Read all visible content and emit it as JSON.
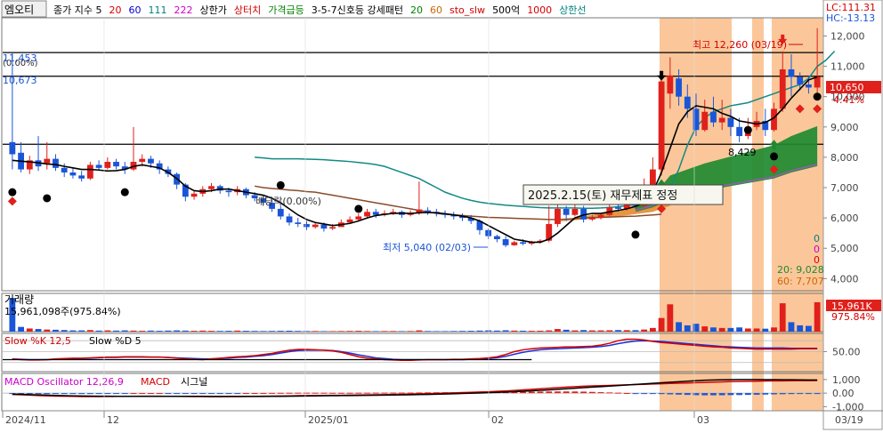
{
  "toolbar": {
    "stock_name": "엠오티",
    "legend": [
      {
        "text": "종가 지수 5",
        "color": "#000000"
      },
      {
        "text": "20",
        "color": "#d40000"
      },
      {
        "text": "60",
        "color": "#0000cc"
      },
      {
        "text": "111",
        "color": "#008080"
      },
      {
        "text": "222",
        "color": "#cc00cc"
      },
      {
        "text": "상한가",
        "color": "#000000"
      },
      {
        "text": "상터치",
        "color": "#d40000"
      },
      {
        "text": "가격급등",
        "color": "#008000"
      },
      {
        "text": "3-5-7신호등 강세패턴",
        "color": "#000000"
      },
      {
        "text": "20",
        "color": "#008000"
      },
      {
        "text": "60",
        "color": "#cc6600"
      },
      {
        "text": "sto_slw",
        "color": "#d40000"
      },
      {
        "text": "500억",
        "color": "#000000"
      },
      {
        "text": "1000",
        "color": "#d40000"
      },
      {
        "text": "상한선",
        "color": "#008080"
      }
    ]
  },
  "price_panel": {
    "lc": "LC:111.31",
    "hc": "HC:-13.13",
    "y_ticks": [
      "12,000",
      "11,000",
      "10,000",
      "9,000",
      "8,000",
      "7,000",
      "6,000",
      "5,000",
      "4,000"
    ],
    "current_price": "10,650",
    "current_pct": "4.41%",
    "high_label": "최고 12,260 (03/19)",
    "low_label": "최저 5,040 (02/03)",
    "level_8429": "8,429",
    "left_11453": "11,453",
    "left_pct": "(0.00%)",
    "left_10673": "10,673",
    "dividend": "배당락(0.00%)",
    "event_label": "2025.2.15(토) 재무제표 정정",
    "zero_labels": [
      "0",
      "0",
      "0"
    ],
    "ma20_label": "20: 9,028",
    "ma60_label": "60: 7,707"
  },
  "volume_panel": {
    "title": "거래량",
    "value": "15,961,098주(975.84%)",
    "badge": "15,961K",
    "badge_pct": "975.84%"
  },
  "stochastic_panel": {
    "title_k": "Slow %K 12,5",
    "title_d": "Slow %D 5",
    "tick": "50.00"
  },
  "macd_panel": {
    "title_osc": "MACD Oscillator 12,26,9",
    "title_macd": "MACD",
    "title_signal": "시그널",
    "ticks": [
      "1,000",
      "0.00",
      "-1,000"
    ]
  },
  "x_axis": {
    "labels": [
      "2024/11",
      "12",
      "2025/01",
      "02",
      "03",
      "03/19"
    ]
  },
  "colors": {
    "up": "#e0201b",
    "down": "#1a55d8",
    "highlight": "#fbc79a",
    "ma_teal": "#108a84",
    "ma_brown": "#8b4a2a",
    "cloud_green": "#1e8a30",
    "cloud_orange": "#e68a2e"
  },
  "chart_data": {
    "type": "candlestick",
    "candles": [
      [
        8500,
        8100,
        11453,
        7600
      ],
      [
        8150,
        7600,
        8500,
        7500
      ],
      [
        7600,
        7900,
        8050,
        7450
      ],
      [
        7900,
        7700,
        8700,
        7550
      ],
      [
        7800,
        7950,
        8500,
        7600
      ],
      [
        7950,
        7650,
        8100,
        7550
      ],
      [
        7650,
        7500,
        7800,
        7350
      ],
      [
        7500,
        7400,
        7650,
        7300
      ],
      [
        7400,
        7300,
        7550,
        7200
      ],
      [
        7300,
        7750,
        7850,
        7250
      ],
      [
        7750,
        7650,
        7900,
        7550
      ],
      [
        7650,
        7850,
        8000,
        7600
      ],
      [
        7850,
        7700,
        7950,
        7600
      ],
      [
        7700,
        7600,
        7850,
        7450
      ],
      [
        7600,
        7850,
        9000,
        7550
      ],
      [
        7850,
        7950,
        8100,
        7700
      ],
      [
        7950,
        7800,
        8050,
        7650
      ],
      [
        7800,
        7600,
        7900,
        7450
      ],
      [
        7600,
        7450,
        7700,
        7350
      ],
      [
        7450,
        7100,
        7500,
        6950
      ],
      [
        7100,
        6700,
        7150,
        6550
      ],
      [
        6700,
        6800,
        6900,
        6600
      ],
      [
        6800,
        6950,
        7050,
        6700
      ],
      [
        6950,
        7050,
        7150,
        6850
      ],
      [
        7050,
        6900,
        7100,
        6800
      ],
      [
        6900,
        6850,
        7000,
        6700
      ],
      [
        6850,
        6950,
        7050,
        6750
      ],
      [
        6950,
        6750,
        7000,
        6650
      ],
      [
        6750,
        6650,
        6850,
        6550
      ],
      [
        6650,
        6500,
        6750,
        6400
      ],
      [
        6500,
        6300,
        6600,
        6200
      ],
      [
        6300,
        6050,
        6400,
        5950
      ],
      [
        6050,
        5850,
        6150,
        5750
      ],
      [
        5850,
        5800,
        6000,
        5700
      ],
      [
        5800,
        5700,
        5900,
        5600
      ],
      [
        5700,
        5780,
        5850,
        5650
      ],
      [
        5780,
        5650,
        5850,
        5550
      ],
      [
        5650,
        5700,
        5800,
        5600
      ],
      [
        5700,
        5850,
        5950,
        5750
      ],
      [
        5850,
        5950,
        6050,
        5850
      ],
      [
        5950,
        6050,
        6150,
        5900
      ],
      [
        6050,
        6200,
        6300,
        6000
      ],
      [
        6200,
        6100,
        6300,
        6000
      ],
      [
        6100,
        6150,
        6250,
        6050
      ],
      [
        6150,
        6200,
        6300,
        6100
      ],
      [
        6200,
        6100,
        6250,
        6000
      ],
      [
        6100,
        6150,
        6250,
        6050
      ],
      [
        6150,
        6280,
        7200,
        6100
      ],
      [
        6250,
        6200,
        6350,
        6100
      ],
      [
        6200,
        6150,
        6300,
        6050
      ],
      [
        6150,
        6100,
        6250,
        6000
      ],
      [
        6100,
        6050,
        6200,
        5950
      ],
      [
        6050,
        6000,
        6150,
        5900
      ],
      [
        6000,
        5900,
        6100,
        5800
      ],
      [
        5900,
        5600,
        5950,
        5450
      ],
      [
        5600,
        5400,
        5650,
        5300
      ],
      [
        5400,
        5300,
        5450,
        5200
      ],
      [
        5300,
        5100,
        5400,
        5040
      ],
      [
        5100,
        5200,
        5250,
        5080
      ],
      [
        5200,
        5150,
        5300,
        5100
      ],
      [
        5150,
        5200,
        5250,
        5100
      ],
      [
        5200,
        5250,
        5300,
        5150
      ],
      [
        5250,
        5800,
        6400,
        5200
      ],
      [
        5800,
        6300,
        6600,
        5700
      ],
      [
        6300,
        6100,
        6400,
        5900
      ],
      [
        6100,
        6300,
        6500,
        6050
      ],
      [
        6300,
        5950,
        6400,
        5850
      ],
      [
        5950,
        6000,
        6100,
        5900
      ],
      [
        6000,
        6100,
        6150,
        5950
      ],
      [
        6100,
        6350,
        6500,
        6050
      ],
      [
        6350,
        6300,
        6450,
        6200
      ],
      [
        6300,
        6500,
        6650,
        6250
      ],
      [
        6500,
        6400,
        6600,
        6300
      ],
      [
        6400,
        6800,
        7300,
        6350
      ],
      [
        6800,
        7600,
        8000,
        6700
      ],
      [
        7600,
        10500,
        10700,
        7400
      ],
      [
        10100,
        10700,
        11300,
        9600
      ],
      [
        10600,
        10000,
        10900,
        9700
      ],
      [
        10000,
        9600,
        10400,
        9300
      ],
      [
        9600,
        8900,
        10100,
        8700
      ],
      [
        8900,
        9500,
        9900,
        8850
      ],
      [
        9500,
        9150,
        10000,
        9000
      ],
      [
        9150,
        9300,
        9900,
        8900
      ],
      [
        9300,
        9000,
        9600,
        8700
      ],
      [
        9000,
        8700,
        9300,
        8500
      ],
      [
        8700,
        9000,
        9300,
        8600
      ],
      [
        9000,
        9200,
        9500,
        8900
      ],
      [
        9200,
        8900,
        9600,
        8700
      ],
      [
        8900,
        9600,
        9800,
        8850
      ],
      [
        9600,
        10900,
        11500,
        9500
      ],
      [
        10900,
        10650,
        11400,
        10000
      ],
      [
        10650,
        10400,
        10800,
        10200
      ],
      [
        10400,
        10300,
        10700,
        10100
      ],
      [
        10300,
        10650,
        12260,
        10100
      ]
    ],
    "volume": [
      3.2,
      0.45,
      0.3,
      0.25,
      0.2,
      0.18,
      0.15,
      0.12,
      0.12,
      0.15,
      0.1,
      0.12,
      0.1,
      0.12,
      0.1,
      0.08,
      0.1,
      0.08,
      0.1,
      0.12,
      0.1,
      0.08,
      0.1,
      0.08,
      0.07,
      0.08,
      0.1,
      0.08,
      0.07,
      0.06,
      0.07,
      0.08,
      0.09,
      0.07,
      0.06,
      0.06,
      0.05,
      0.05,
      0.06,
      0.07,
      0.08,
      0.06,
      0.05,
      0.06,
      0.06,
      0.05,
      0.06,
      0.12,
      0.06,
      0.05,
      0.05,
      0.06,
      0.07,
      0.08,
      0.1,
      0.12,
      0.1,
      0.13,
      0.1,
      0.09,
      0.08,
      0.09,
      0.12,
      0.25,
      0.18,
      0.12,
      0.15,
      0.12,
      0.12,
      0.13,
      0.15,
      0.14,
      0.14,
      0.2,
      0.35,
      1.3,
      2.6,
      0.9,
      0.6,
      0.75,
      0.5,
      0.4,
      0.35,
      0.35,
      0.4,
      0.3,
      0.3,
      0.28,
      0.4,
      2.7,
      0.9,
      0.6,
      0.55,
      2.8
    ],
    "ma_teal_start": 28,
    "ma_teal": [
      8000,
      7980,
      7950,
      7950,
      7950,
      7950,
      7940,
      7930,
      7920,
      7900,
      7880,
      7860,
      7830,
      7800,
      7760,
      7700,
      7600,
      7500,
      7400,
      7300,
      7150,
      7000,
      6850,
      6750,
      6650,
      6580,
      6520,
      6480,
      6450,
      6420,
      6400,
      6380,
      6360,
      6340,
      6330,
      6330,
      6330,
      6330,
      6320,
      6320,
      6330,
      6350,
      6370,
      6400,
      6450,
      6500,
      6550,
      6700,
      7000,
      7600,
      8400,
      9000,
      9300,
      9500,
      9600,
      9700,
      9750,
      9800,
      9900,
      10000,
      10100,
      10200,
      10300,
      10400,
      10600,
      11000,
      11200,
      11500
    ],
    "ma_brown_start": 28,
    "ma_brown": [
      7050,
      7000,
      6970,
      6950,
      6920,
      6900,
      6870,
      6850,
      6800,
      6750,
      6700,
      6650,
      6600,
      6550,
      6500,
      6450,
      6400,
      6350,
      6300,
      6250,
      6200,
      6150,
      6120,
      6100,
      6080,
      6060,
      6040,
      6020,
      6010,
      6000,
      5990,
      5980,
      5970,
      5960,
      5950,
      5950,
      5960,
      5980,
      6000,
      6010,
      6020,
      6030,
      6040,
      6050,
      6060,
      6080,
      6100,
      6120
    ],
    "ma5": [
      7900,
      7870,
      7850,
      7820,
      7780,
      7760,
      7700,
      7650,
      7600,
      7600,
      7580,
      7550,
      7560,
      7600,
      7700,
      7750,
      7700,
      7650,
      7500,
      7300,
      7050,
      6900,
      6870,
      6900,
      6950,
      6950,
      6900,
      6850,
      6800,
      6750,
      6650,
      6500,
      6300,
      6100,
      5950,
      5850,
      5800,
      5750,
      5780,
      5820,
      5900,
      6000,
      6080,
      6120,
      6150,
      6160,
      6150,
      6170,
      6180,
      6170,
      6140,
      6100,
      6060,
      6000,
      5900,
      5750,
      5600,
      5450,
      5300,
      5250,
      5200,
      5200,
      5300,
      5500,
      5750,
      6000,
      6100,
      6150,
      6150,
      6200,
      6250,
      6300,
      6380,
      6500,
      6850,
      7500,
      8300,
      9100,
      9500,
      9700,
      9650,
      9600,
      9450,
      9350,
      9200,
      9150,
      9100,
      9150,
      9300,
      9600,
      9950,
      10250,
      10550,
      10650
    ],
    "cloud_upper": [
      [
        72,
        6400
      ],
      [
        74,
        6700
      ],
      [
        76,
        7400
      ],
      [
        80,
        7800
      ],
      [
        84,
        8100
      ],
      [
        88,
        8400
      ],
      [
        90,
        8700
      ],
      [
        93,
        9028
      ]
    ],
    "cloud_lower": [
      [
        72,
        6200
      ],
      [
        74,
        6350
      ],
      [
        76,
        6600
      ],
      [
        80,
        6900
      ],
      [
        84,
        7100
      ],
      [
        88,
        7300
      ],
      [
        90,
        7500
      ],
      [
        93,
        7707
      ]
    ],
    "orange_cloud_upper": [
      [
        63,
        5900
      ],
      [
        66,
        6050
      ],
      [
        70,
        6250
      ],
      [
        74,
        6600
      ],
      [
        76,
        7000
      ]
    ],
    "orange_cloud_lower": [
      [
        63,
        5880
      ],
      [
        66,
        5950
      ],
      [
        70,
        6050
      ],
      [
        74,
        6200
      ],
      [
        76,
        6400
      ]
    ],
    "stoch_k": [
      30,
      28,
      27,
      27,
      28,
      30,
      31,
      32,
      32,
      33,
      34,
      35,
      35,
      36,
      36,
      36,
      35,
      35,
      34,
      32,
      30,
      29,
      28,
      30,
      32,
      34,
      36,
      37,
      39,
      42,
      45,
      50,
      54,
      56,
      56,
      55,
      54,
      52,
      48,
      42,
      36,
      32,
      30,
      28,
      27,
      26,
      26,
      27,
      28,
      28,
      28,
      29,
      29,
      30,
      31,
      33,
      36,
      42,
      50,
      55,
      58,
      60,
      61,
      62,
      63,
      63,
      64,
      65,
      68,
      73,
      80,
      84,
      84,
      82,
      78,
      75,
      73,
      71,
      69,
      67,
      65,
      63,
      62,
      60,
      59,
      58,
      57,
      57,
      57,
      57,
      57,
      58,
      58,
      58
    ],
    "stoch_d": [
      30,
      29,
      28,
      28,
      28,
      29,
      30,
      31,
      31,
      32,
      33,
      34,
      34,
      35,
      35,
      35,
      35,
      35,
      34,
      33,
      32,
      31,
      30,
      30,
      31,
      32,
      34,
      35,
      37,
      39,
      42,
      46,
      50,
      53,
      54,
      54,
      54,
      53,
      50,
      46,
      41,
      37,
      33,
      31,
      29,
      28,
      28,
      28,
      28,
      28,
      28,
      28,
      28,
      29,
      30,
      31,
      33,
      37,
      43,
      48,
      52,
      55,
      57,
      58,
      59,
      60,
      61,
      62,
      64,
      67,
      72,
      76,
      79,
      80,
      79,
      78,
      76,
      74,
      72,
      70,
      68,
      66,
      64,
      63,
      62,
      61,
      60,
      60,
      60,
      60,
      59,
      59,
      59,
      59
    ],
    "macd": [
      -100,
      -120,
      -150,
      -180,
      -200,
      -220,
      -230,
      -240,
      -250,
      -250,
      -250,
      -245,
      -240,
      -240,
      -235,
      -230,
      -230,
      -230,
      -235,
      -240,
      -245,
      -250,
      -255,
      -260,
      -260,
      -255,
      -250,
      -245,
      -240,
      -230,
      -220,
      -210,
      -200,
      -190,
      -180,
      -175,
      -170,
      -165,
      -160,
      -150,
      -140,
      -130,
      -120,
      -110,
      -100,
      -90,
      -80,
      -60,
      -40,
      -20,
      0,
      20,
      40,
      60,
      80,
      100,
      130,
      160,
      200,
      240,
      280,
      320,
      360,
      400,
      440,
      480,
      510,
      530,
      550,
      570,
      590,
      610,
      630,
      650,
      670,
      690,
      710,
      730,
      750,
      770,
      790,
      810,
      830,
      850,
      860,
      870,
      880,
      890,
      900,
      905,
      910,
      915,
      920,
      925
    ],
    "signal": [
      -80,
      -90,
      -110,
      -130,
      -150,
      -170,
      -185,
      -200,
      -210,
      -220,
      -225,
      -230,
      -233,
      -235,
      -236,
      -236,
      -235,
      -234,
      -234,
      -235,
      -236,
      -238,
      -240,
      -243,
      -246,
      -248,
      -248,
      -248,
      -246,
      -243,
      -238,
      -232,
      -226,
      -218,
      -210,
      -203,
      -196,
      -189,
      -182,
      -175,
      -168,
      -160,
      -152,
      -144,
      -136,
      -128,
      -118,
      -106,
      -93,
      -78,
      -62,
      -45,
      -27,
      -8,
      12,
      32,
      55,
      80,
      108,
      138,
      170,
      205,
      240,
      278,
      318,
      360,
      400,
      440,
      480,
      520,
      560,
      600,
      640,
      680,
      720,
      760,
      800,
      840,
      880,
      920,
      950,
      970,
      985,
      995,
      1000,
      1000,
      998,
      995,
      990,
      985,
      980,
      975,
      970,
      965
    ]
  }
}
